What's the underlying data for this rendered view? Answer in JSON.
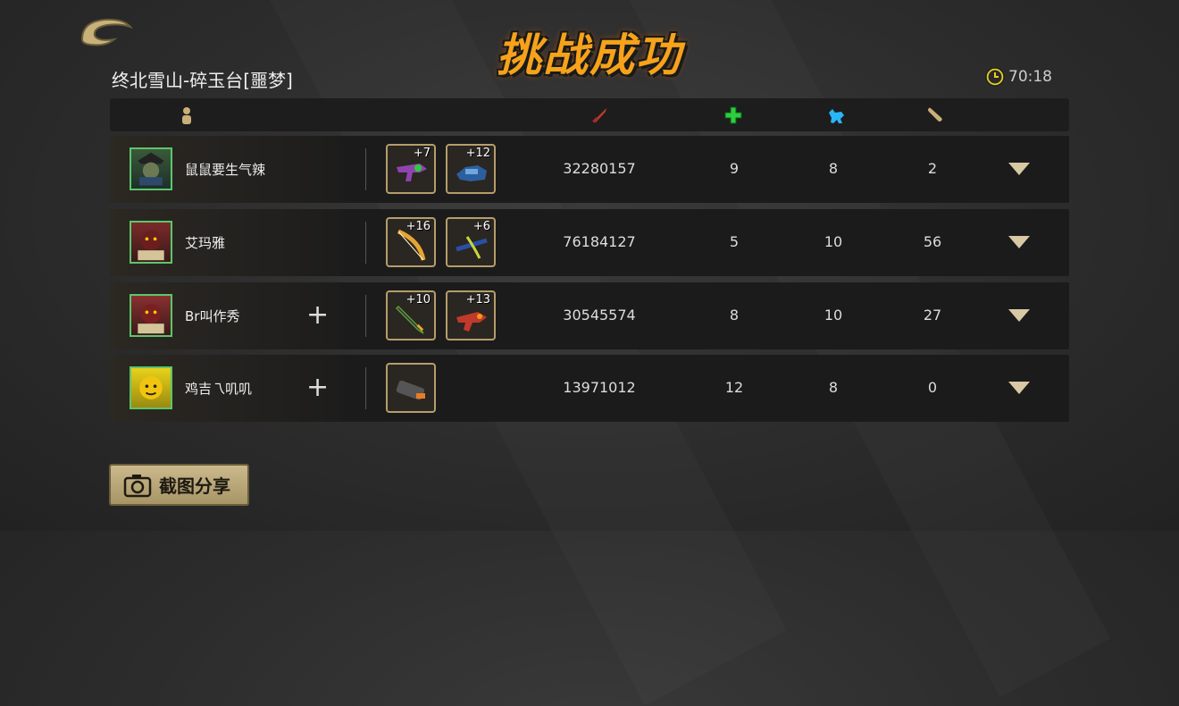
{
  "header": {
    "title": "挑战成功",
    "stage": "终北雪山-碎玉台[噩梦]",
    "timer": "70:18",
    "timer_icon": "clock-icon",
    "title_color": "#f6a21a"
  },
  "table": {
    "columns": [
      {
        "icon": "player-icon",
        "color": "#c9b07a"
      },
      {
        "icon": "damage-icon",
        "color": "#c0392b"
      },
      {
        "icon": "heal-icon",
        "color": "#2ecc40"
      },
      {
        "icon": "pet-icon",
        "color": "#29b6f6"
      },
      {
        "icon": "bone-icon",
        "color": "#c9b07a"
      }
    ],
    "rows": [
      {
        "name": "鼠鼠要生气辣",
        "weapons": [
          "+7",
          "+12"
        ],
        "damage": "32280157",
        "heal": "9",
        "pet": "8",
        "bone": "2",
        "can_add": false
      },
      {
        "name": "艾玛雅",
        "weapons": [
          "+16",
          "+6"
        ],
        "damage": "76184127",
        "heal": "5",
        "pet": "10",
        "bone": "56",
        "can_add": false
      },
      {
        "name": "Br叫作秀",
        "weapons": [
          "+10",
          "+13"
        ],
        "damage": "30545574",
        "heal": "8",
        "pet": "10",
        "bone": "27",
        "can_add": true
      },
      {
        "name": "鸡吉乁叽叽",
        "weapons": [
          ""
        ],
        "damage": "13971012",
        "heal": "12",
        "pet": "8",
        "bone": "0",
        "can_add": true
      }
    ]
  },
  "share": {
    "label": "截图分享",
    "icon": "camera-icon"
  },
  "colors": {
    "gold": "#b59d6a",
    "row_bg": "#1b1b1b",
    "avatar_border": "#5cc66a"
  }
}
